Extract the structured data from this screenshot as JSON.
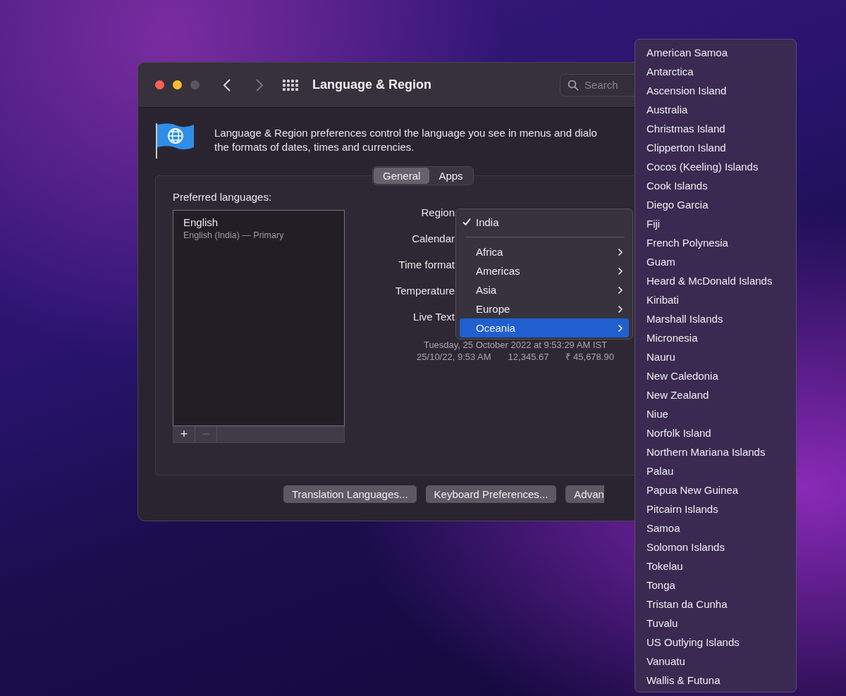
{
  "window": {
    "title": "Language & Region",
    "search": {
      "placeholder": "Search"
    },
    "description": [
      "Language & Region preferences control the language you see in menus and dialo",
      "the formats of dates, times and currencies."
    ],
    "tabs": [
      {
        "label": "General",
        "selected": true
      },
      {
        "label": "Apps",
        "selected": false
      }
    ],
    "preferred_languages": {
      "label": "Preferred languages:",
      "items": [
        {
          "name": "English",
          "detail": "English (India) — Primary"
        }
      ],
      "list_buttons": [
        {
          "label": "+",
          "disabled": false
        },
        {
          "label": "−",
          "disabled": true
        }
      ]
    },
    "settings": [
      "Region",
      "Calendar",
      "Time format",
      "Temperature",
      "Live Text"
    ],
    "samples": [
      "Tuesday, 25 October 2022 at 9:53:29 AM IST",
      "25/10/22, 9:53 AM",
      "12,345.67",
      "₹ 45,678.90"
    ],
    "buttons": [
      "Translation Languages...",
      "Keyboard Preferences...",
      "Advan"
    ]
  },
  "region_menu": {
    "items": [
      {
        "kind": "choice",
        "label": "India",
        "checked": true,
        "selected": false
      },
      {
        "kind": "separator"
      },
      {
        "kind": "submenu",
        "label": "Africa",
        "selected": false
      },
      {
        "kind": "submenu",
        "label": "Americas",
        "selected": false
      },
      {
        "kind": "submenu",
        "label": "Asia",
        "selected": false
      },
      {
        "kind": "submenu",
        "label": "Europe",
        "selected": false
      },
      {
        "kind": "submenu",
        "label": "Oceania",
        "selected": true
      }
    ]
  },
  "submenu": {
    "items": [
      "American Samoa",
      "Antarctica",
      "Ascension Island",
      "Australia",
      "Christmas Island",
      "Clipperton Island",
      "Cocos (Keeling) Islands",
      "Cook Islands",
      "Diego Garcia",
      "Fiji",
      "French Polynesia",
      "Guam",
      "Heard & McDonald Islands",
      "Kiribati",
      "Marshall Islands",
      "Micronesia",
      "Nauru",
      "New Caledonia",
      "New Zealand",
      "Niue",
      "Norfolk Island",
      "Northern Mariana Islands",
      "Palau",
      "Papua New Guinea",
      "Pitcairn Islands",
      "Samoa",
      "Solomon Islands",
      "Tokelau",
      "Tonga",
      "Tristan da Cunha",
      "Tuvalu",
      "US Outlying Islands",
      "Vanuatu",
      "Wallis & Futuna"
    ]
  }
}
